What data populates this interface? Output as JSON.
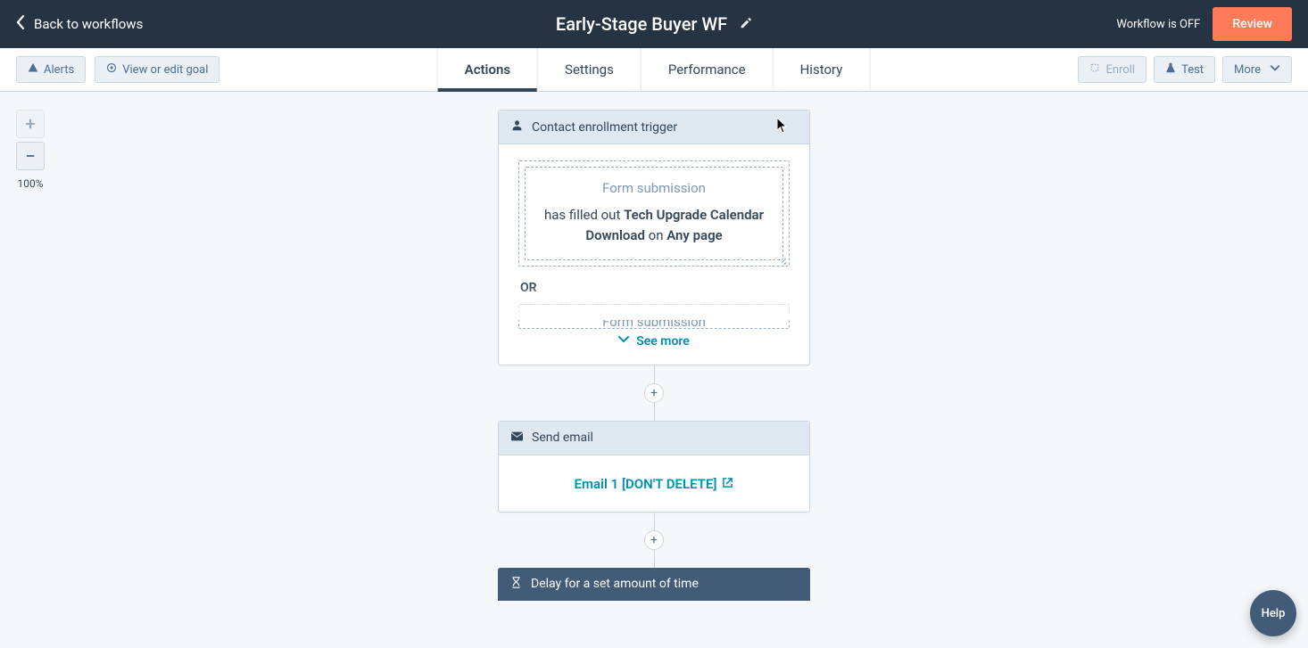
{
  "header": {
    "back_label": "Back to workflows",
    "title": "Early-Stage Buyer WF",
    "status": "Workflow is OFF",
    "review_label": "Review"
  },
  "toolbar": {
    "alerts_label": "Alerts",
    "goal_label": "View or edit goal",
    "tabs": {
      "actions": "Actions",
      "settings": "Settings",
      "performance": "Performance",
      "history": "History"
    },
    "enroll_label": "Enroll",
    "test_label": "Test",
    "more_label": "More"
  },
  "zoom": {
    "plus": "+",
    "minus": "−",
    "level": "100%"
  },
  "trigger_card": {
    "header": "Contact enrollment trigger",
    "form_title": "Form submission",
    "prefix": "has filled out ",
    "form_name": "Tech Upgrade Calendar Download",
    "middle": " on ",
    "page": "Any page",
    "or_label": "OR",
    "peek_title": "Form submission",
    "see_more": "See more"
  },
  "email_card": {
    "header": "Send email",
    "link_label": "Email 1 [DON'T DELETE]"
  },
  "delay_card": {
    "header": "Delay for a set amount of time"
  },
  "add_node": "+",
  "help": "Help"
}
